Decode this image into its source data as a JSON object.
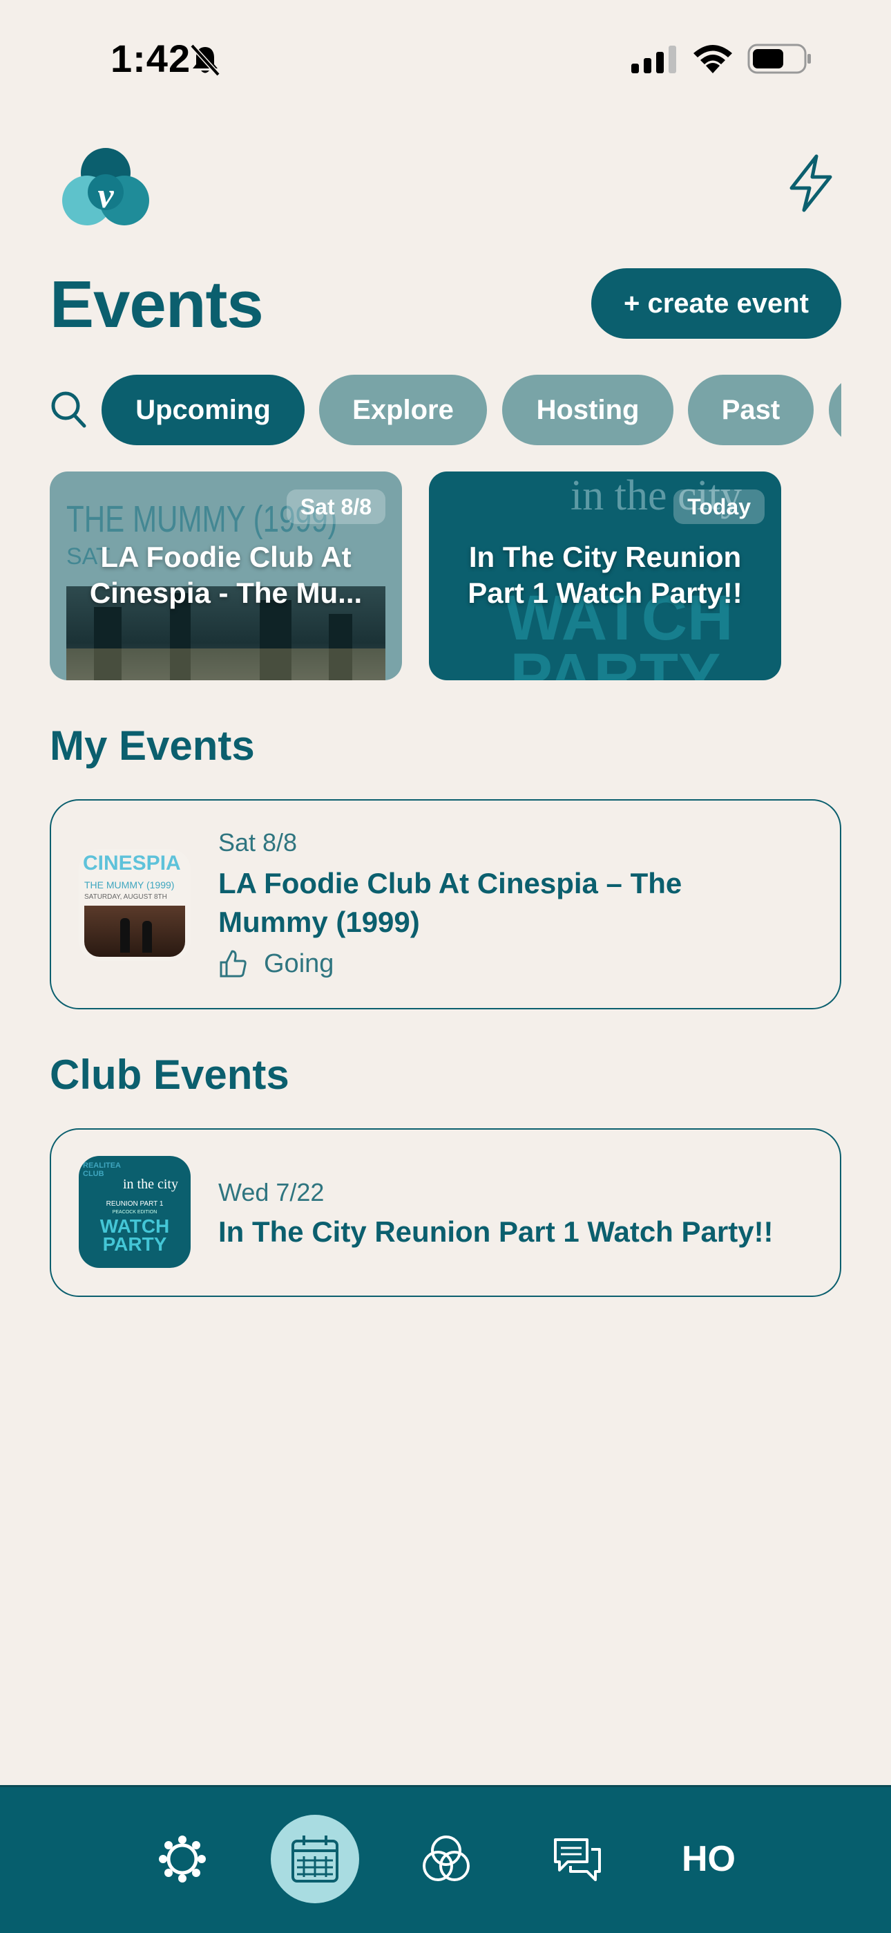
{
  "status_bar": {
    "time": "1:42"
  },
  "header": {
    "title": "Events",
    "create_label": "+ create event"
  },
  "filters": [
    {
      "label": "Upcoming",
      "active": true
    },
    {
      "label": "Explore",
      "active": false
    },
    {
      "label": "Hosting",
      "active": false
    },
    {
      "label": "Past",
      "active": false
    }
  ],
  "featured": [
    {
      "date": "Sat 8/8",
      "title": "LA Foodie Club At Cinespia - The Mu...",
      "poster_text": "THE MUMMY (1999)",
      "poster_subtext": "SAT"
    },
    {
      "date": "Today",
      "title": "In The City Reunion Part 1 Watch Party!!",
      "poster_text": "in the city",
      "poster_subtext": "WATCH PARTY"
    }
  ],
  "my_events": {
    "heading": "My Events",
    "items": [
      {
        "date": "Sat 8/8",
        "title": "LA Foodie Club At Cinespia – The Mummy (1999)",
        "rsvp": "Going",
        "thumb_brand": "CINESPIA",
        "thumb_line1": "THE MUMMY (1999)",
        "thumb_line2": "SATURDAY, AUGUST 8TH"
      }
    ]
  },
  "club_events": {
    "heading": "Club Events",
    "items": [
      {
        "date": "Wed 7/22",
        "title": "In The City Reunion Part 1 Watch Party!!",
        "thumb_line1": "in the city",
        "thumb_line2": "REUNION PART 1",
        "thumb_line3": "PEACOCK EDITION",
        "thumb_line4": "WATCH",
        "thumb_line5": "PARTY",
        "thumb_badge": "REALITEA CLUB"
      }
    ]
  },
  "bottom_nav": [
    {
      "icon": "community-icon",
      "active": false
    },
    {
      "icon": "calendar-icon",
      "active": true
    },
    {
      "icon": "circles-icon",
      "active": false
    },
    {
      "icon": "chat-icon",
      "active": false
    },
    {
      "icon": "profile-initials",
      "label": "HO",
      "active": false
    }
  ],
  "colors": {
    "primary": "#0B5F6E",
    "background": "#F4EFEA",
    "chip_inactive": "#79A4A7",
    "nav_active": "#A9DCE1"
  }
}
